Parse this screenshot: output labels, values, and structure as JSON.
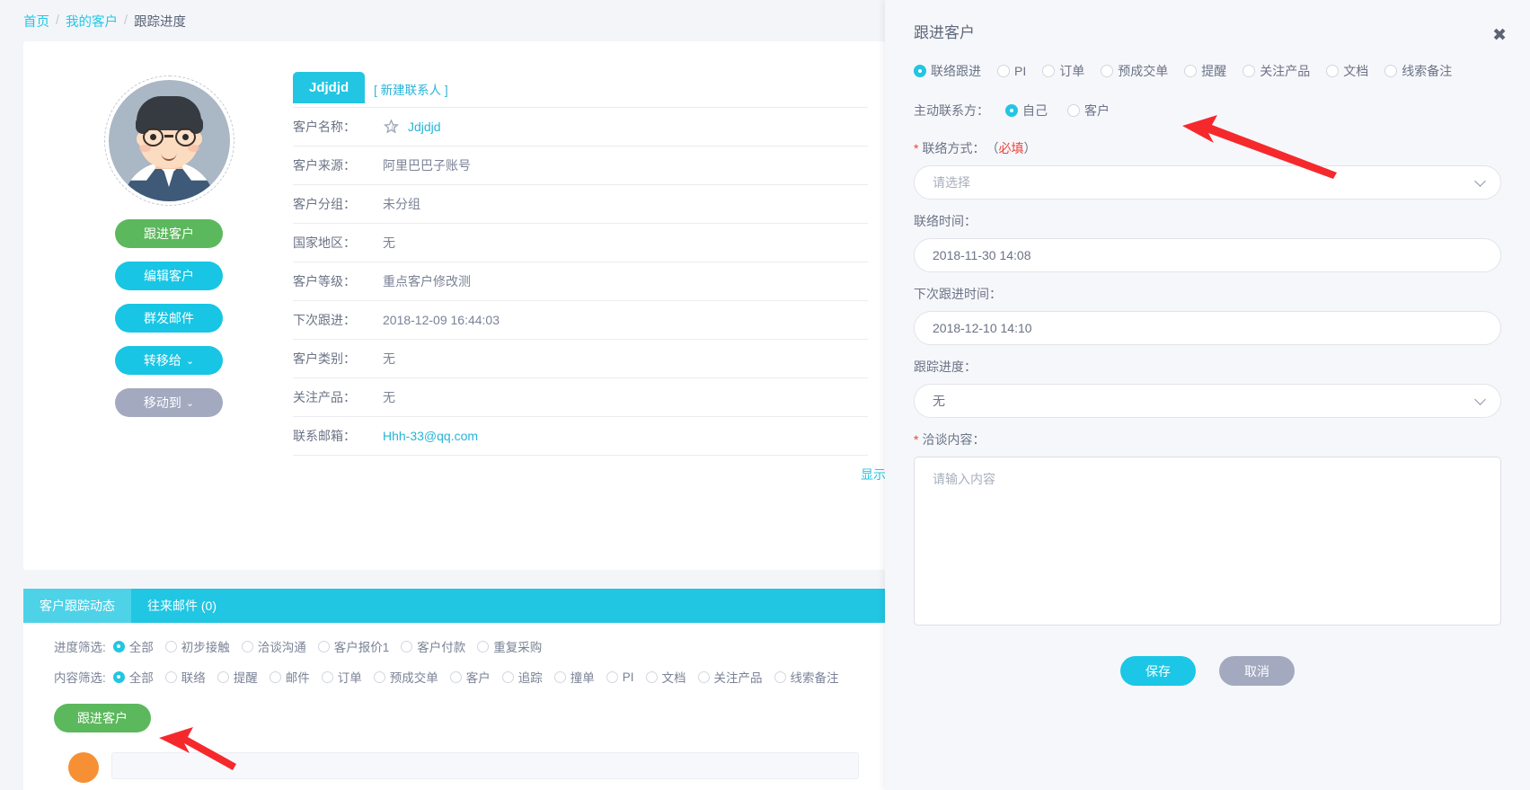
{
  "breadcrumb": {
    "home": "首页",
    "sep": "/",
    "my_customers": "我的客户",
    "current": "跟踪进度"
  },
  "profile": {
    "actions": [
      {
        "label": "跟进客户",
        "style": "green",
        "caret": ""
      },
      {
        "label": "编辑客户",
        "style": "cyan",
        "caret": ""
      },
      {
        "label": "群发邮件",
        "style": "cyan",
        "caret": ""
      },
      {
        "label": "转移给",
        "style": "cyan",
        "caret": "⌄"
      },
      {
        "label": "移动到",
        "style": "grey",
        "caret": "⌄"
      }
    ]
  },
  "detail": {
    "contact_chip": "Jdjdjd",
    "new_contact": "[ 新建联系人 ]",
    "rows": [
      {
        "label": "客户名称：",
        "value": "Jdjdjd",
        "link": true,
        "star": true
      },
      {
        "label": "客户来源：",
        "value": "阿里巴巴子账号",
        "link": false,
        "star": false
      },
      {
        "label": "客户分组：",
        "value": "未分组",
        "link": false,
        "star": false
      },
      {
        "label": "国家地区：",
        "value": "无",
        "link": false,
        "star": false
      },
      {
        "label": "客户等级：",
        "value": "重点客户修改测",
        "link": false,
        "star": false
      },
      {
        "label": "下次跟进：",
        "value": "2018-12-09 16:44:03",
        "link": false,
        "star": false
      },
      {
        "label": "客户类别：",
        "value": "无",
        "link": false,
        "star": false
      },
      {
        "label": "关注产品：",
        "value": "无",
        "link": false,
        "star": false
      },
      {
        "label": "联系邮箱：",
        "value": "Hhh-33@qq.com",
        "link": true,
        "star": false
      }
    ],
    "show_more": "显示"
  },
  "bottom": {
    "tabs": [
      {
        "label": "客户跟踪动态",
        "active": true
      },
      {
        "label": "往来邮件 (0)",
        "active": false
      }
    ],
    "progress_filter": {
      "label": "进度筛选:",
      "options": [
        "全部",
        "初步接触",
        "洽谈沟通",
        "客户报价1",
        "客户付款",
        "重复采购"
      ],
      "selected": "全部"
    },
    "content_filter": {
      "label": "内容筛选:",
      "options": [
        "全部",
        "联络",
        "提醒",
        "邮件",
        "订单",
        "预成交单",
        "客户",
        "追踪",
        "撞单",
        "PI",
        "文档",
        "关注产品",
        "线索备注"
      ],
      "selected": "全部"
    },
    "follow_button": "跟进客户"
  },
  "drawer": {
    "title": "跟进客户",
    "close": "✖",
    "type_options": [
      "联络跟进",
      "PI",
      "订单",
      "预成交单",
      "提醒",
      "关注产品",
      "文档",
      "线索备注"
    ],
    "type_selected": "联络跟进",
    "initiator": {
      "label": "主动联系方：",
      "options": [
        "自己",
        "客户"
      ],
      "selected": "自己"
    },
    "contact_method": {
      "label": "联络方式：",
      "required_note_open": "（",
      "required_note": "必填",
      "required_note_close": "）",
      "value": "请选择"
    },
    "contact_time": {
      "label": "联络时间：",
      "value": "2018-11-30 14:08"
    },
    "next_follow_time": {
      "label": "下次跟进时间：",
      "value": "2018-12-10 14:10"
    },
    "track_progress": {
      "label": "跟踪进度：",
      "value": "无"
    },
    "talk_content": {
      "label": "洽谈内容：",
      "placeholder": "请输入内容"
    },
    "save": "保存",
    "cancel": "取消"
  },
  "colors": {
    "accent_cyan": "#22c6e2",
    "green": "#5cb85c",
    "grey": "#a3a9bf",
    "red": "#f04134",
    "arrow_red": "#f5292c"
  }
}
